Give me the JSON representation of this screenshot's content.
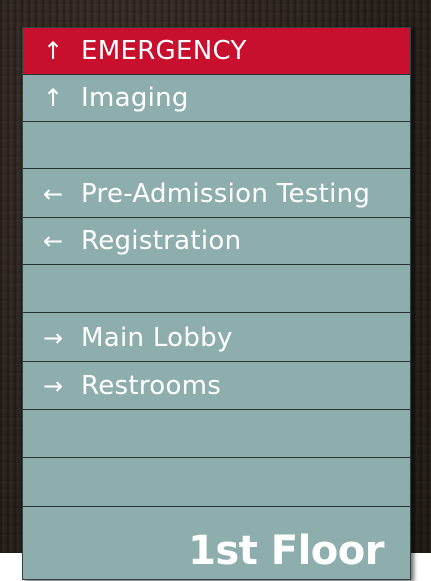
{
  "sign": {
    "rows": [
      {
        "arrow": "↑",
        "label": "EMERGENCY"
      },
      {
        "arrow": "↑",
        "label": "Imaging"
      },
      {
        "arrow": "",
        "label": ""
      },
      {
        "arrow": "←",
        "label": "Pre-Admission Testing"
      },
      {
        "arrow": "←",
        "label": "Registration"
      },
      {
        "arrow": "",
        "label": ""
      },
      {
        "arrow": "→",
        "label": "Main Lobby"
      },
      {
        "arrow": "→",
        "label": "Restrooms"
      },
      {
        "arrow": "",
        "label": ""
      },
      {
        "arrow": "",
        "label": ""
      }
    ],
    "floor_label": "1st Floor"
  },
  "colors": {
    "emergency_red": "#c8102e",
    "panel_teal": "#8eaeae",
    "text": "#ffffff",
    "wall": "#2e2620"
  },
  "icons": {
    "up": "arrow-up-icon",
    "left": "arrow-left-icon",
    "right": "arrow-right-icon"
  }
}
